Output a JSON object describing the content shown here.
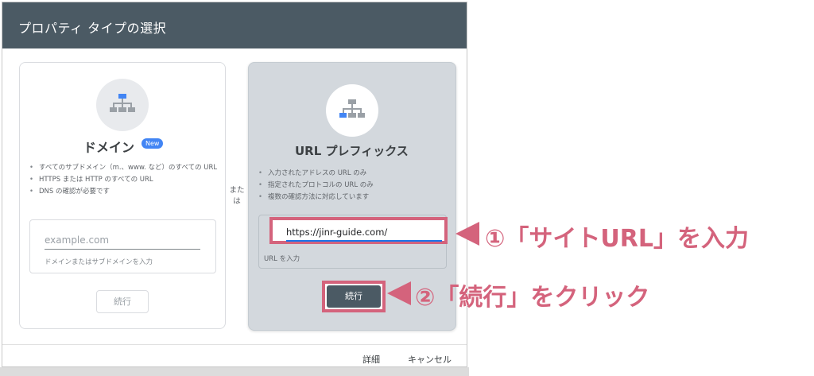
{
  "dialog": {
    "title": "プロパティ タイプの選択",
    "or_label": "また は"
  },
  "domain_card": {
    "title": "ドメイン",
    "badge": "New",
    "bullets": [
      "すべてのサブドメイン（m.、www. など）のすべての URL",
      "HTTPS または HTTP のすべての URL",
      "DNS の確認が必要です"
    ],
    "input_placeholder": "example.com",
    "input_help": "ドメインまたはサブドメインを入力",
    "continue_label": "続行",
    "icon": "sitemap-icon"
  },
  "url_card": {
    "title": "URL プレフィックス",
    "bullets": [
      "入力されたアドレスの URL のみ",
      "指定されたプロトコルの URL のみ",
      "複数の確認方法に対応しています"
    ],
    "input_value": "https://jinr-guide.com/",
    "input_help": "URL を入力",
    "continue_label": "続行",
    "icon": "sitemap-icon"
  },
  "footer": {
    "details_label": "詳細",
    "cancel_label": "キャンセル"
  },
  "annotations": {
    "step1": "①「サイトURL」を入力",
    "step2": "②「続行」をクリック"
  },
  "colors": {
    "header": "#4b5a64",
    "accent": "#d4637c",
    "link_blue": "#1a73e8",
    "badge": "#4285f4"
  }
}
